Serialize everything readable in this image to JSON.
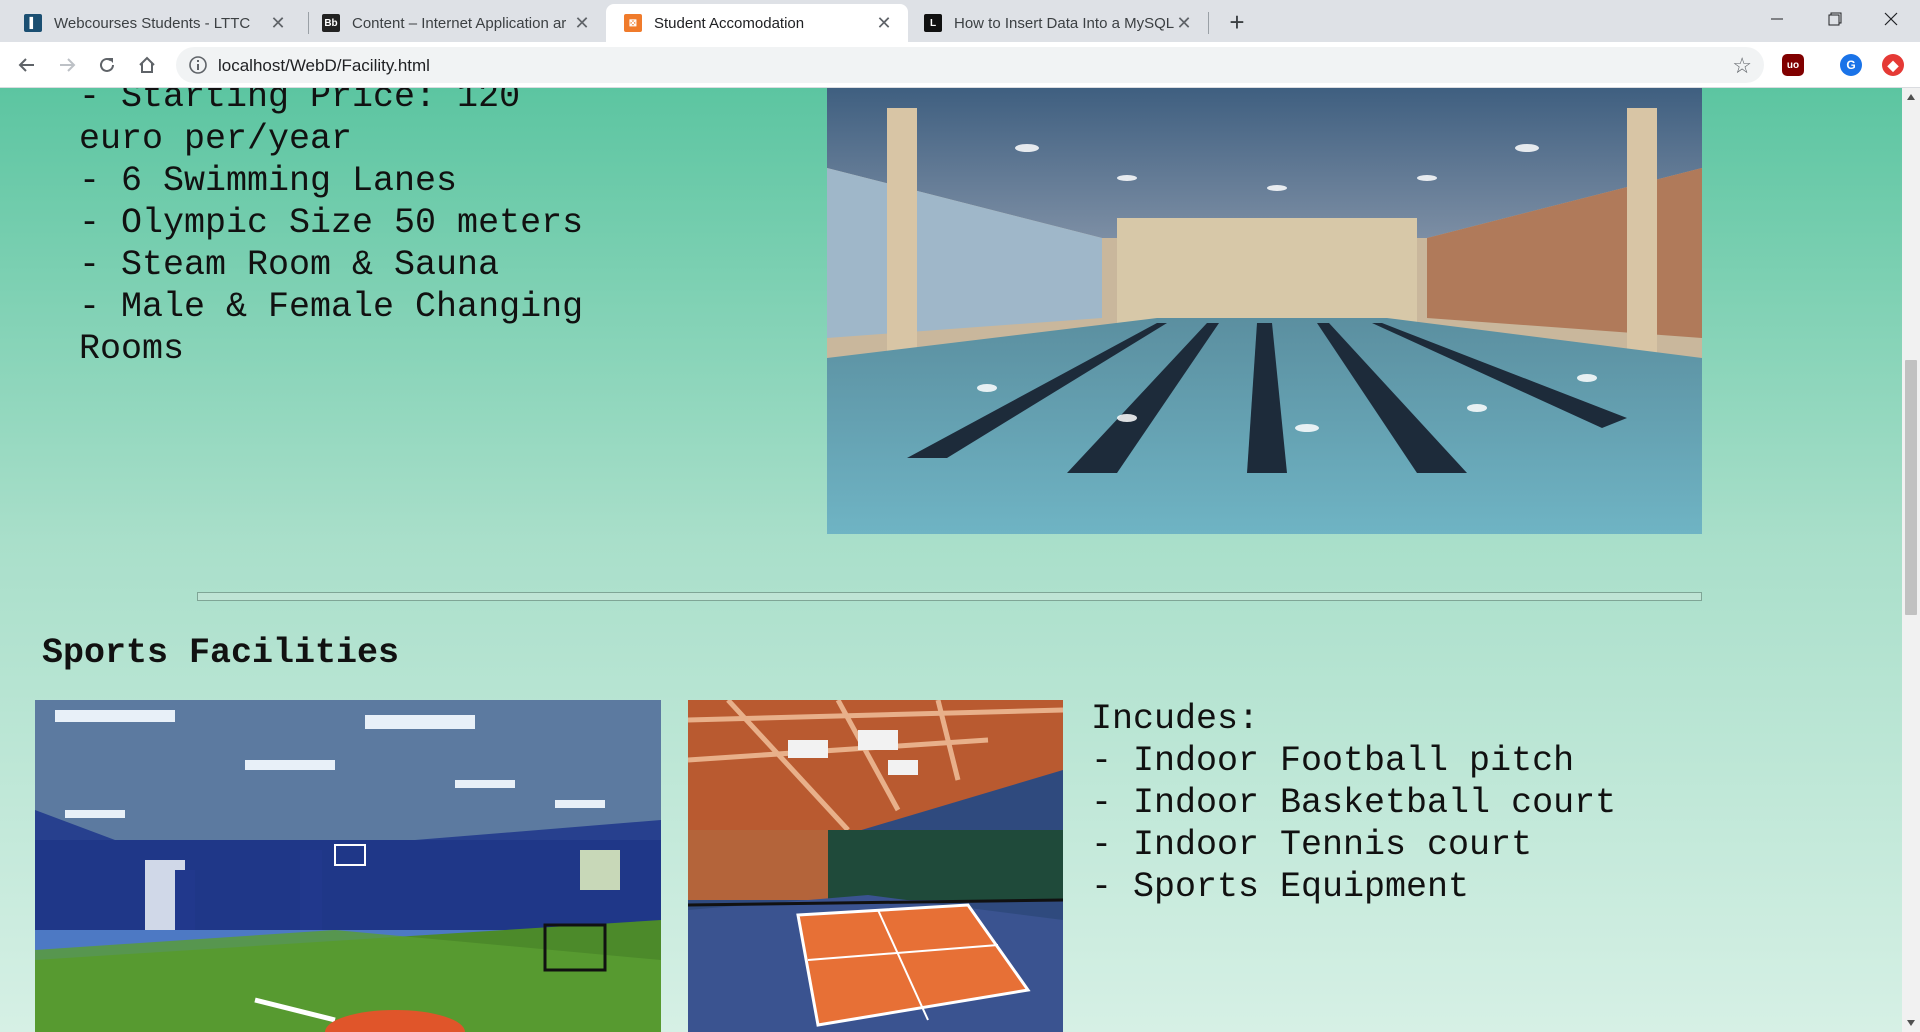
{
  "browser": {
    "tabs": [
      {
        "title": "Webcourses Students - LTTC",
        "favicon": "webcourses-icon",
        "active": false
      },
      {
        "title": "Content – Internet Application ar",
        "favicon": "blackboard-icon",
        "active": false
      },
      {
        "title": "Student Accomodation",
        "favicon": "xampp-icon",
        "active": true
      },
      {
        "title": "How to Insert Data Into a MySQL",
        "favicon": "lifewire-icon",
        "active": false
      }
    ],
    "close_glyph": "✕",
    "new_tab_glyph": "+",
    "url": "localhost/WebD/Facility.html",
    "star_glyph": "☆",
    "profile_initial": "G",
    "ublock_label": "uo"
  },
  "pool": {
    "lines": [
      "- Starting Price: 120",
      "euro per/year",
      "- 6 Swimming Lanes",
      "- Olympic Size 50 meters",
      "- Steam Room & Sauna",
      "- Male & Female Changing",
      "Rooms"
    ],
    "image": "swimming-pool-photo"
  },
  "sports": {
    "heading": "Sports Facilities",
    "lines": [
      "Incudes:",
      "- Indoor Football pitch",
      "- Indoor Basketball court",
      "- Indoor Tennis court",
      "- Sports Equipment"
    ],
    "images": [
      "indoor-gym-photo",
      "tennis-court-photo"
    ]
  },
  "colors": {
    "page_gradient_top": "#5cc5a1",
    "page_gradient_bottom": "#d6f0e5",
    "text": "#111111"
  }
}
